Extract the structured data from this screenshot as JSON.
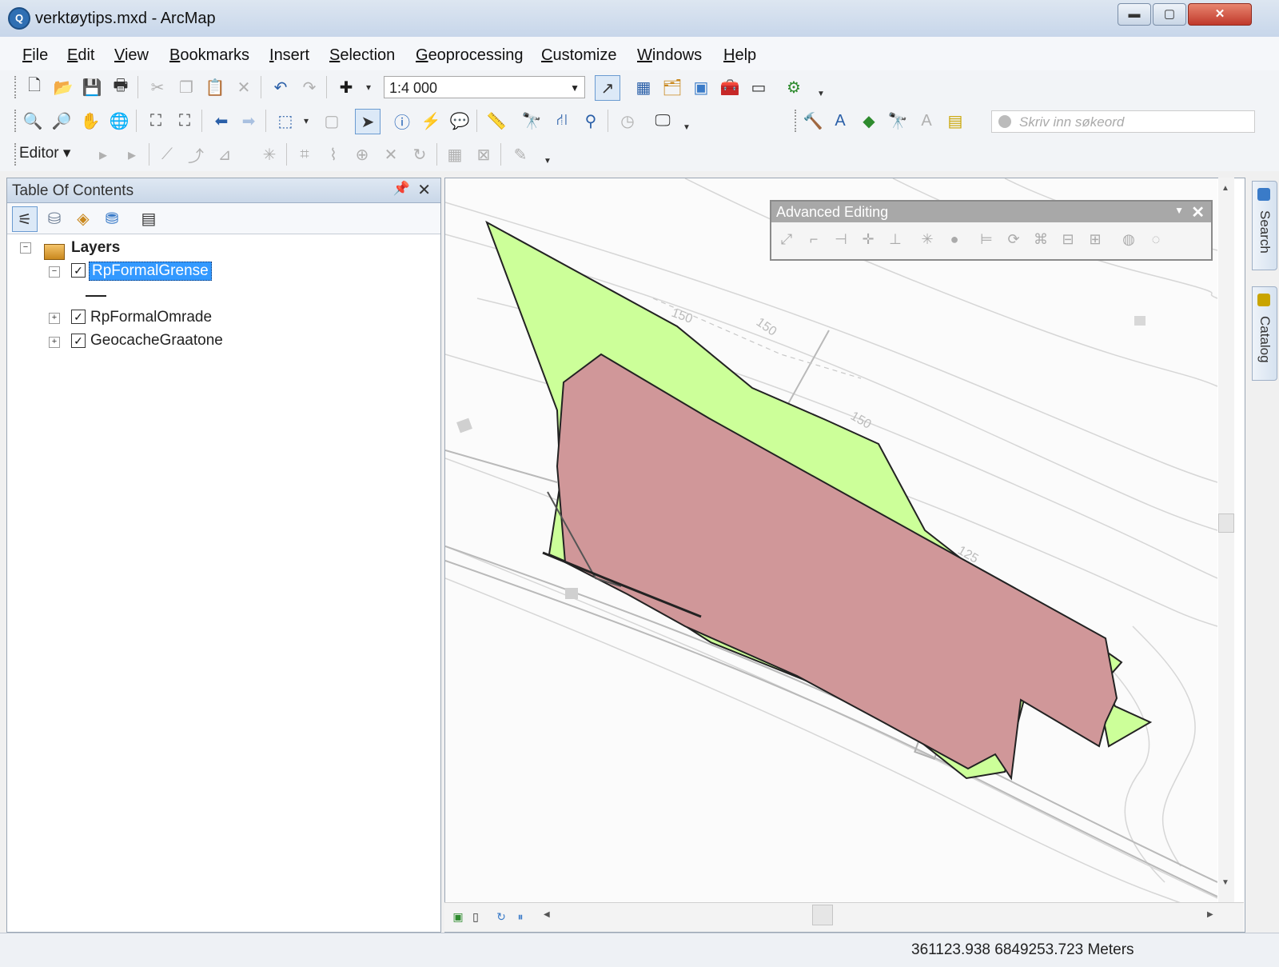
{
  "window": {
    "title": "verktøytips.mxd - ArcMap",
    "min_glyph": "▬",
    "max_glyph": "▢",
    "close_glyph": "✕"
  },
  "menu": [
    "File",
    "Edit",
    "View",
    "Bookmarks",
    "Insert",
    "Selection",
    "Geoprocessing",
    "Customize",
    "Windows",
    "Help"
  ],
  "toolbar": {
    "scale": "1:4 000",
    "search_placeholder": "Skriv inn søkeord",
    "editor_label": "Editor ▾"
  },
  "toc": {
    "title": "Table Of Contents",
    "root": "Layers",
    "layers": [
      {
        "name": "RpFormalGrense",
        "checked": true,
        "expanded": true,
        "selected": true
      },
      {
        "name": "RpFormalOmrade",
        "checked": true,
        "expanded": false,
        "selected": false
      },
      {
        "name": "GeocacheGraatone",
        "checked": true,
        "expanded": false,
        "selected": false
      }
    ],
    "pin_glyph": "📌",
    "close_glyph": "✕"
  },
  "advanced_editing": {
    "title": "Advanced Editing",
    "close_glyph": "✕"
  },
  "side_tabs": [
    "Search",
    "Catalog"
  ],
  "map": {
    "contour_labels": [
      "150",
      "150",
      "150",
      "125"
    ],
    "colors": {
      "green_polygon": "#ccff99",
      "red_polygon": "#d09799",
      "outline": "#222222"
    }
  },
  "status": {
    "coordinates": "361123.938  6849253.723 Meters"
  }
}
